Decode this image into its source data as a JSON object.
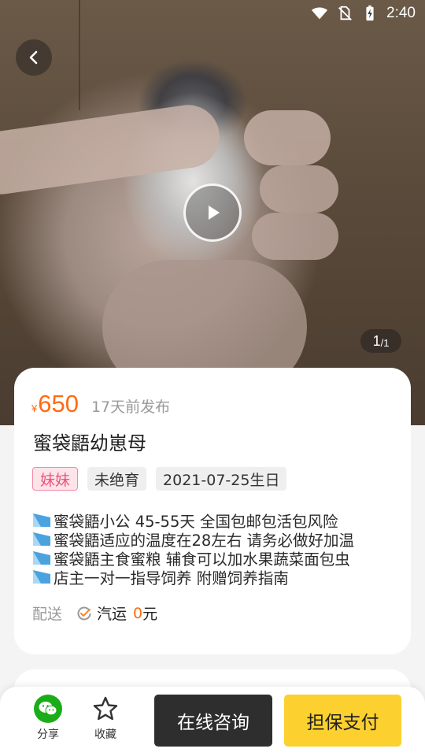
{
  "status_bar": {
    "time": "2:40",
    "icons": [
      "wifi-icon",
      "no-sim-icon",
      "battery-charging-icon"
    ]
  },
  "media": {
    "indicator_current": "1",
    "indicator_total": "/1",
    "icons": [
      "back-arrow-icon",
      "play-icon"
    ]
  },
  "listing": {
    "currency": "¥",
    "price": "650",
    "posted": "17天前发布",
    "title": "蜜袋鼯幼崽母",
    "tags": [
      "妹妹",
      "未绝育",
      "2021-07-25生日"
    ],
    "description": [
      "蜜袋鼯小公 45-55天 全国包邮包活包风险",
      "蜜袋鼯适应的温度在28左右 请务必做好加温",
      "蜜袋鼯主食蜜粮 辅食可以加水果蔬菜面包虫",
      "店主一对一指导饲养 附赠饲养指南"
    ],
    "delivery_label": "配送",
    "delivery_method": "汽运",
    "delivery_fee": "0",
    "delivery_unit": "元"
  },
  "bottom_bar": {
    "share_label": "分享",
    "favorite_label": "收藏",
    "consult_label": "在线咨询",
    "pay_label": "担保支付"
  },
  "colors": {
    "accent_orange": "#ff6a13",
    "pay_yellow": "#fcd02e",
    "consult_dark": "#2e2e2e",
    "wechat_green": "#1aad19",
    "tag_pink": "#e8557a"
  }
}
